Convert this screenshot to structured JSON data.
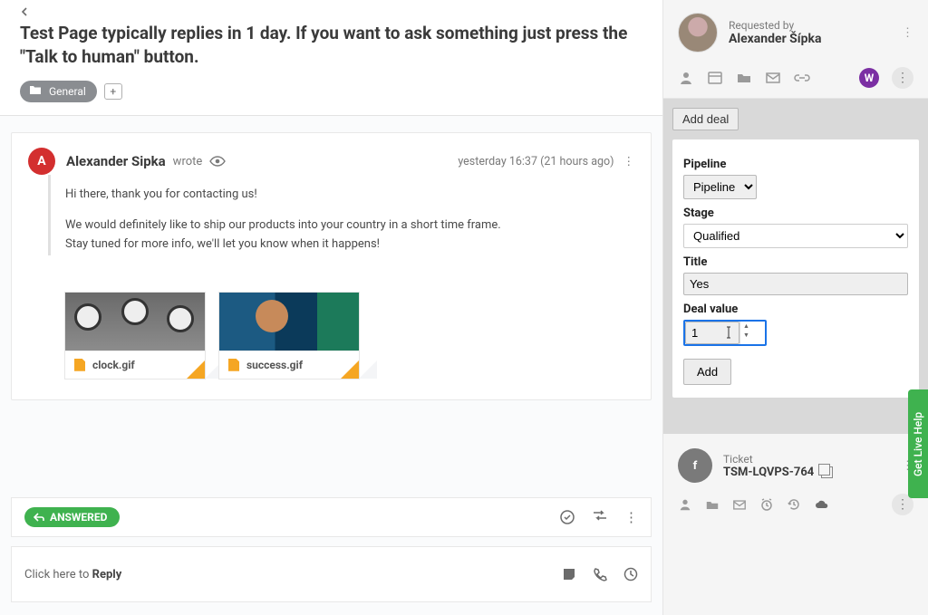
{
  "header": {
    "headline": "Test Page typically replies in 1 day. If you want to ask something just press the \"Talk to human\" button.",
    "tag_label": "General"
  },
  "message": {
    "avatar_initial": "A",
    "author": "Alexander Sipka",
    "wrote": "wrote",
    "timestamp": "yesterday 16:37 (21 hours ago)",
    "body_p1": "Hi there, thank you for contacting us!",
    "body_p2": "We would definitely like to ship our products into your country in a short time frame.",
    "body_p3": "Stay tuned for more info, we'll let you know when it happens!",
    "attachments": [
      {
        "filename": "clock.gif"
      },
      {
        "filename": "success.gif"
      }
    ]
  },
  "status": {
    "answered_label": "ANSWERED"
  },
  "reply": {
    "prefix": "Click here to ",
    "bold": "Reply"
  },
  "sidebar": {
    "requested_by_label": "Requested by",
    "requested_by_name": "Alexander Šípka",
    "w_badge": "W",
    "deal": {
      "add_deal": "Add deal",
      "pipeline_label": "Pipeline",
      "pipeline_value": "Pipeline",
      "stage_label": "Stage",
      "stage_value": "Qualified",
      "title_label": "Title",
      "title_value": "Yes",
      "deal_value_label": "Deal value",
      "deal_value": "1",
      "add_btn": "Add"
    },
    "ticket_label": "Ticket",
    "ticket_id": "TSM-LQVPS-764",
    "ticket_initial": "f"
  },
  "live_help": "Get Live Help"
}
